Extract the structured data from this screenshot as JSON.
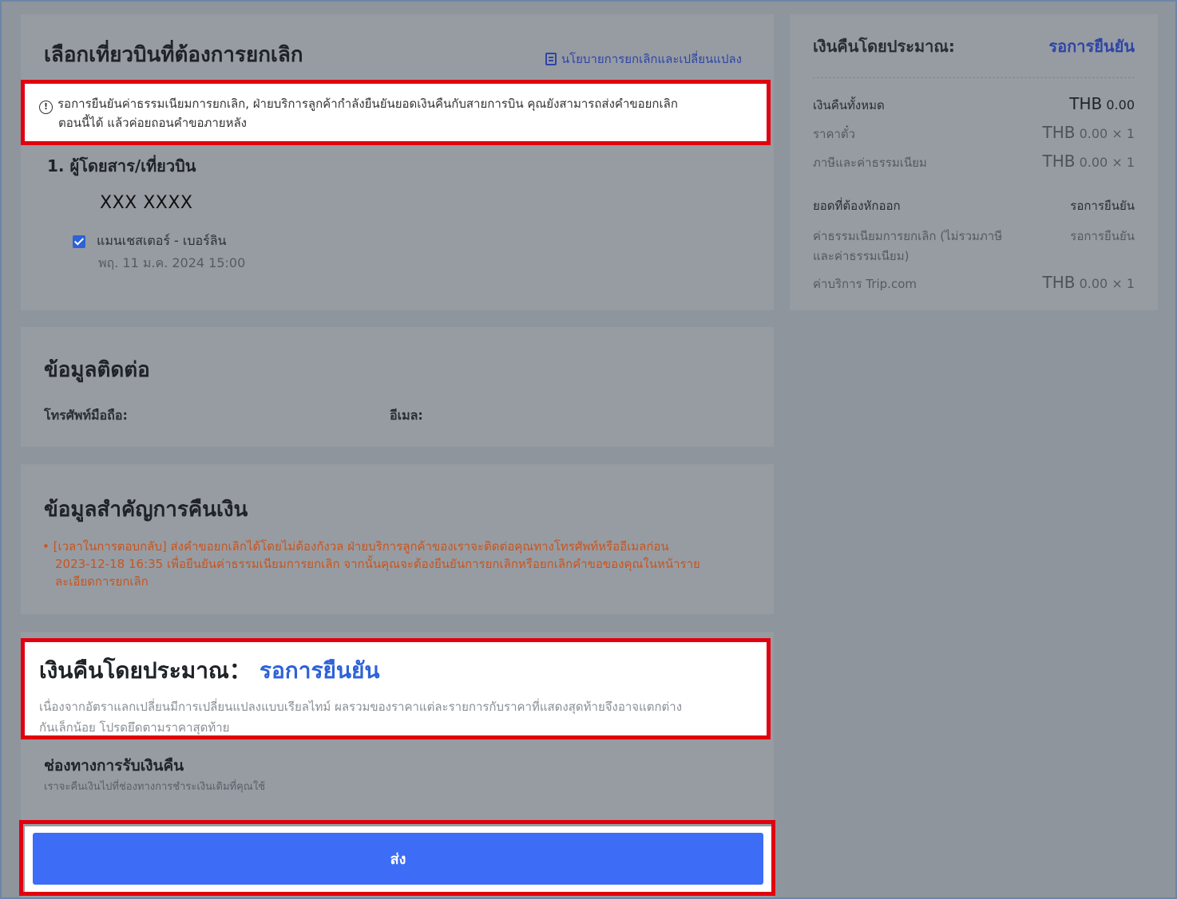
{
  "select_flight": {
    "title": "เลือกเที่ยวบินที่ต้องการยกเลิก",
    "policy_link": "นโยบายการยกเลิกและเปลี่ยนแปลง",
    "notice_line1": "รอการยืนยันค่าธรรมเนียมการยกเลิก,  ฝ่ายบริการลูกค้ากำลังยืนยันยอดเงินคืนกับสายการบิน คุณยังสามารถส่งคำขอยกเลิก",
    "notice_line2": "ตอนนี้ได้ แล้วค่อยถอนคำขอภายหลัง",
    "section_label": "1.  ผู้โดยสาร/เที่ยวบิน",
    "passenger_name": "XXX XXXX",
    "route": "แมนเชสเตอร์ - เบอร์ลิน",
    "flight_date": "พฤ. 11 ม.ค. 2024 15:00",
    "route_checked": true
  },
  "contact": {
    "title": "ข้อมูลติดต่อ",
    "phone_label": "โทรศัพท์มือถือ:",
    "email_label": "อีเมล:"
  },
  "refund_info": {
    "title": "ข้อมูลสำคัญการคืนเงิน",
    "line1": "[เวลาในการตอบกลับ] ส่งคำขอยกเลิกได้โดยไม่ต้องกังวล ฝ่ายบริการลูกค้าของเราจะติดต่อคุณทางโทรศัพท์หรืออีเมลก่อน",
    "line2": "2023-12-18 16:35 เพื่อยืนยันค่าธรรมเนียมการยกเลิก จากนั้นคุณจะต้องยืนยันการยกเลิกหรือยกเลิกคำขอของคุณในหน้าราย",
    "line3": "ละเอียดการยกเลิก"
  },
  "estimate": {
    "title": "เงินคืนโดยประมาณ：",
    "status": "รอการยืนยัน",
    "desc_line1": "เนื่องจากอัตราแลกเปลี่ยนมีการเปลี่ยนแปลงแบบเรียลไทม์ ผลรวมของราคาแต่ละรายการกับราคาที่แสดงสุดท้ายจึงอาจแตกต่าง",
    "desc_line2": "กันเล็กน้อย โปรดยึดตามราคาสุดท้าย"
  },
  "channel": {
    "title": "ช่องทางการรับเงินคืน",
    "subtitle": "เราจะคืนเงินไปที่ช่องทางการชำระเงินเดิมที่คุณใช้"
  },
  "submit_label": "ส่ง",
  "summary": {
    "title": "เงินคืนโดยประมาณ:",
    "status": "รอการยืนยัน",
    "total_label": "เงินคืนทั้งหมด",
    "total_currency": "THB",
    "total_value": "0.00",
    "fare_label": "ราคาตั๋ว",
    "fare_currency": "THB",
    "fare_value": "0.00 × 1",
    "tax_label": "ภาษีและค่าธรรมเนียม",
    "tax_currency": "THB",
    "tax_value": "0.00 × 1",
    "deduct_label": "ยอดที่ต้องหักออก",
    "deduct_value": "รอการยืนยัน",
    "cancel_fee_label_line1": "ค่าธรรมเนียมการยกเลิก (ไม่รวมภาษี",
    "cancel_fee_label_line2": "และค่าธรรมเนียม)",
    "cancel_fee_value": "รอการยืนยัน",
    "service_fee_label": "ค่าบริการ Trip.com",
    "service_fee_currency": "THB",
    "service_fee_value": "0.00 × 1"
  },
  "colors": {
    "highlight": "#e1000f",
    "accent_blue": "#2d62d8",
    "submit_blue": "#3d6cf6",
    "notice_orange": "#c9541c"
  }
}
